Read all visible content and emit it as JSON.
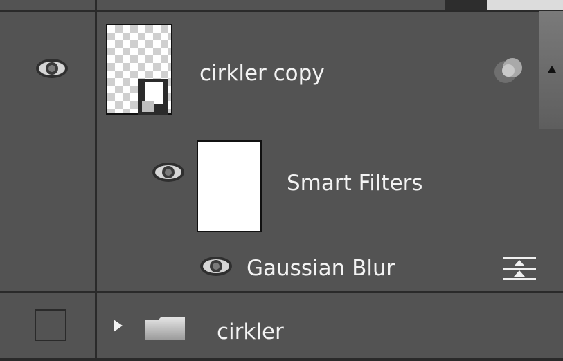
{
  "layers": [
    {
      "name": "cirkler copy",
      "visible_icon": "eye-icon",
      "thumbnail": "transparent-smart-object",
      "badge_icon": "smart-object-badge-icon",
      "effects_icon": "fx-circles-icon"
    },
    {
      "name": "Smart Filters",
      "visible_icon": "eye-icon",
      "thumbnail": "white-mask"
    },
    {
      "name": "Gaussian Blur",
      "visible_icon": "eye-icon",
      "options_icon": "filter-blending-options-icon"
    },
    {
      "name": "cirkler",
      "visible_icon": "visibility-checkbox",
      "expand_icon": "triangle-right-icon",
      "type_icon": "folder-icon"
    }
  ],
  "colors": {
    "panel_bg": "#535353",
    "divider": "#2a2a2a",
    "text": "#f3f3f3"
  }
}
